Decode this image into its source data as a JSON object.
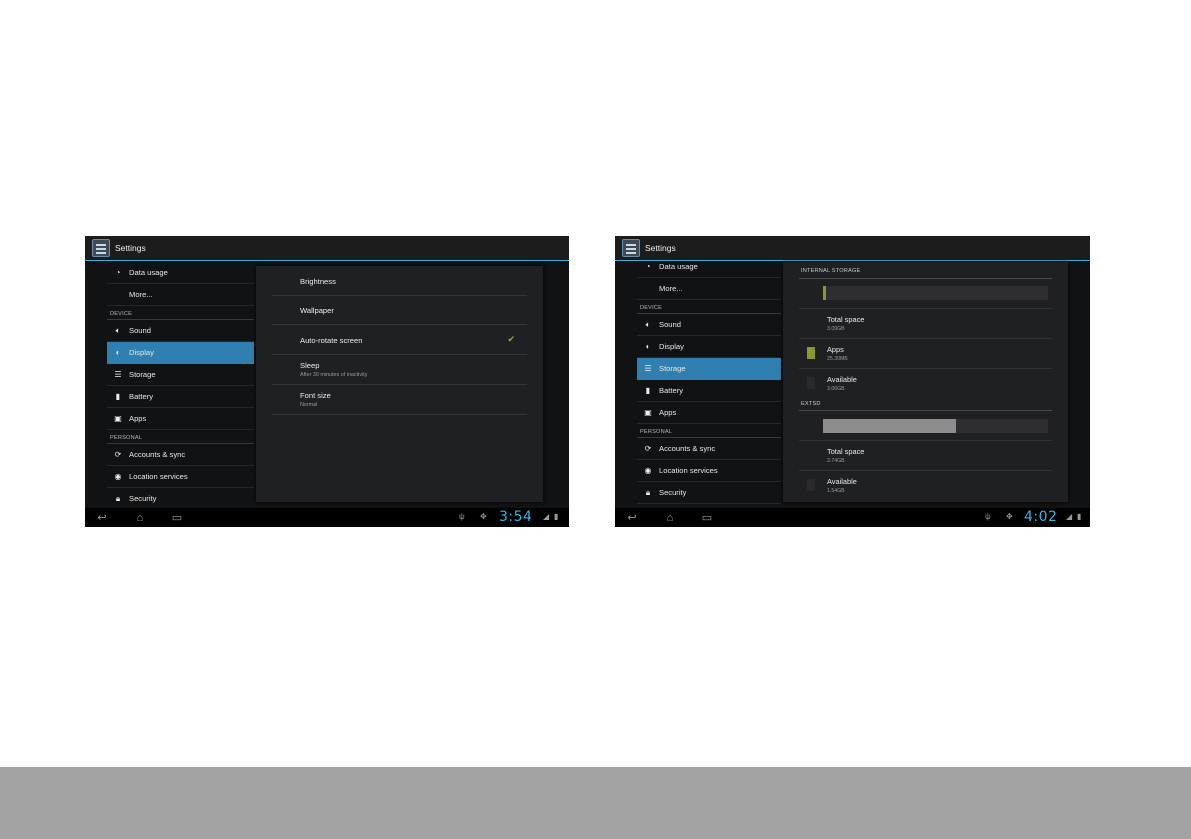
{
  "left_screen": {
    "app_title": "Settings",
    "sidebar": {
      "data_usage": "Data usage",
      "more": "More...",
      "device_header": "DEVICE",
      "sound": "Sound",
      "display": "Display",
      "storage": "Storage",
      "battery": "Battery",
      "apps": "Apps",
      "personal_header": "PERSONAL",
      "accounts_sync": "Accounts & sync",
      "location_services": "Location services",
      "security": "Security"
    },
    "display_settings": {
      "brightness": "Brightness",
      "wallpaper": "Wallpaper",
      "auto_rotate": "Auto-rotate screen",
      "auto_rotate_checked": true,
      "sleep": "Sleep",
      "sleep_summary": "After 30 minutes of inactivity",
      "font_size": "Font size",
      "font_size_summary": "Normal"
    },
    "clock": "3:54"
  },
  "right_screen": {
    "app_title": "Settings",
    "sidebar": {
      "data_usage": "Data usage",
      "more": "More...",
      "device_header": "DEVICE",
      "sound": "Sound",
      "display": "Display",
      "storage": "Storage",
      "battery": "Battery",
      "apps": "Apps",
      "personal_header": "PERSONAL",
      "accounts_sync": "Accounts & sync",
      "location_services": "Location services",
      "security": "Security"
    },
    "storage": {
      "internal_header": "INTERNAL STORAGE",
      "internal_used_fraction": 0.01,
      "internal_total_label": "Total space",
      "internal_total_value": "3.09GB",
      "apps_label": "Apps",
      "apps_value": "25.30MB",
      "internal_available_label": "Available",
      "internal_available_value": "3.06GB",
      "extsd_header": "EXTSD",
      "extsd_used_fraction": 0.59,
      "extsd_total_label": "Total space",
      "extsd_total_value": "3.74GB",
      "extsd_available_label": "Available",
      "extsd_available_value": "1.54GB"
    },
    "clock": "4:02"
  },
  "colors": {
    "holo_blue": "#33b5e5",
    "selected_row": "#2f7fb0",
    "apps_bar": "#8a9a2a",
    "extsd_bar": "#8c8c8c",
    "check_green": "#7fbf2a",
    "footer_gray": "#a3a3a3"
  }
}
